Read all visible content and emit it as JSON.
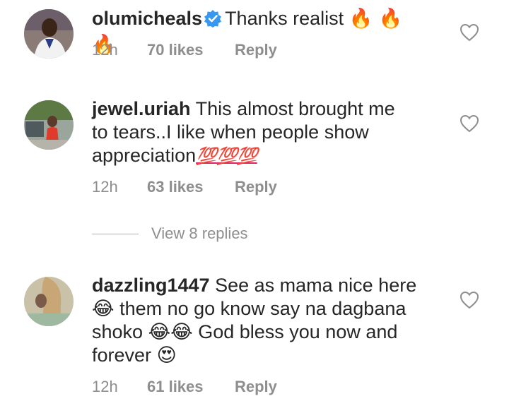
{
  "comments": [
    {
      "username": "olumicheals",
      "verified": true,
      "text": "Thanks realist",
      "emoji": "🔥 🔥 🔥",
      "time": "12h",
      "likes": "70 likes",
      "reply": "Reply"
    },
    {
      "username": "jewel.uriah",
      "text_line1": "This almost brought me",
      "text_line2": "to tears..I like when people show",
      "text_line3": "appreciation",
      "emoji": "💯💯💯",
      "time": "12h",
      "likes": "63 likes",
      "reply": "Reply"
    },
    {
      "username": "dazzling1447",
      "text_line1": "See as mama nice here",
      "emoji1": "😂",
      "text_line2": "them no go know say na dagbana",
      "text_line3a": "shoko",
      "emoji2": "😂😂",
      "text_line3b": "God bless you now and",
      "text_line4": "forever",
      "emoji3": "😍",
      "time": "12h",
      "likes": "61 likes",
      "reply": "Reply"
    }
  ],
  "view_replies": "View 8 replies",
  "colors": {
    "text": "#262626",
    "meta": "#8e8e8e",
    "verified": "#3897f0"
  }
}
